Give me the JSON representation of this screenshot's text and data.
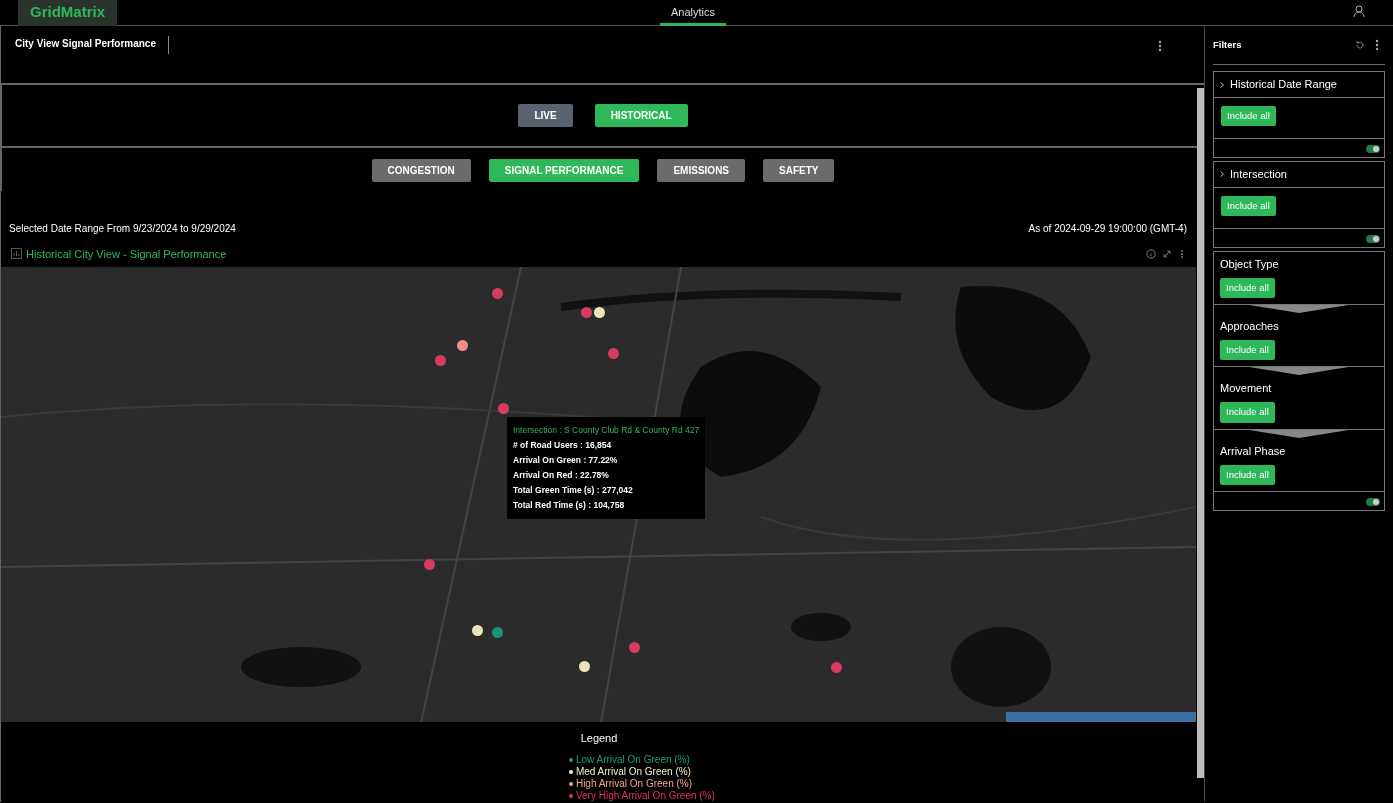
{
  "topbar": {
    "logo": "GridMatrix",
    "tabs": [
      {
        "label": "Analytics",
        "selected": true
      }
    ]
  },
  "panel": {
    "title": "City View Signal Performance"
  },
  "modes": [
    {
      "label": "LIVE",
      "selected": false
    },
    {
      "label": "HISTORICAL",
      "selected": true
    }
  ],
  "categories": [
    {
      "label": "CONGESTION",
      "selected": false
    },
    {
      "label": "SIGNAL PERFORMANCE",
      "selected": true
    },
    {
      "label": "EMISSIONS",
      "selected": false
    },
    {
      "label": "SAFETY",
      "selected": false
    }
  ],
  "date_range": "Selected Date Range From 9/23/2024 to 9/29/2024",
  "as_of": "As of 2024-09-29 19:00:00 (GMT-4)",
  "map": {
    "title": "Historical City View - Signal Performance",
    "markers": [
      {
        "color": "#d93a5f"
      },
      {
        "color": "#d93a5f"
      },
      {
        "color": "#ebe6b8"
      },
      {
        "color": "#f08f8a"
      },
      {
        "color": "#d93a5f"
      },
      {
        "color": "#d93a5f"
      },
      {
        "color": "#d93a5f"
      },
      {
        "color": "#d93a5f"
      },
      {
        "color": "#ebe6b8"
      },
      {
        "color": "#1a9474"
      },
      {
        "color": "#ebe6b8"
      },
      {
        "color": "#d93a5f"
      },
      {
        "color": "#d93a5f"
      }
    ],
    "tooltip": {
      "heading": "Intersection : S County Club Rd & County Rd 427",
      "rows": [
        "# of Road Users : 16,854",
        "Arrival On Green : 77.22%",
        "Arrival On Red : 22.78%",
        "Total Green Time (s) : 277,042",
        "Total Red Time (s) : 104,758"
      ]
    }
  },
  "legend": {
    "title": "Legend",
    "items": [
      {
        "label": "Low Arrival On Green (%)",
        "color": "#1a9e78"
      },
      {
        "label": "Med Arrival On Green (%)",
        "color": "#f3f0c8"
      },
      {
        "label": "High Arrival On Green (%)",
        "color": "#f4a582"
      },
      {
        "label": "Very High Arrival On Green (%)",
        "color": "#e0325a"
      }
    ]
  },
  "filters": {
    "title": "Filters",
    "sections": [
      {
        "label": "Historical Date Range",
        "kind": "collapsible",
        "button": "Include all",
        "toggle_on": true
      },
      {
        "label": "Intersection",
        "kind": "collapsible",
        "button": "Include all",
        "toggle_on": true
      },
      {
        "label": "Object Type",
        "kind": "step",
        "button": "Include all"
      },
      {
        "label": "Approaches",
        "kind": "step",
        "button": "Include all"
      },
      {
        "label": "Movement",
        "kind": "step",
        "button": "Include all"
      },
      {
        "label": "Arrival Phase",
        "kind": "step",
        "button": "Include all",
        "toggle_on": true
      }
    ]
  }
}
